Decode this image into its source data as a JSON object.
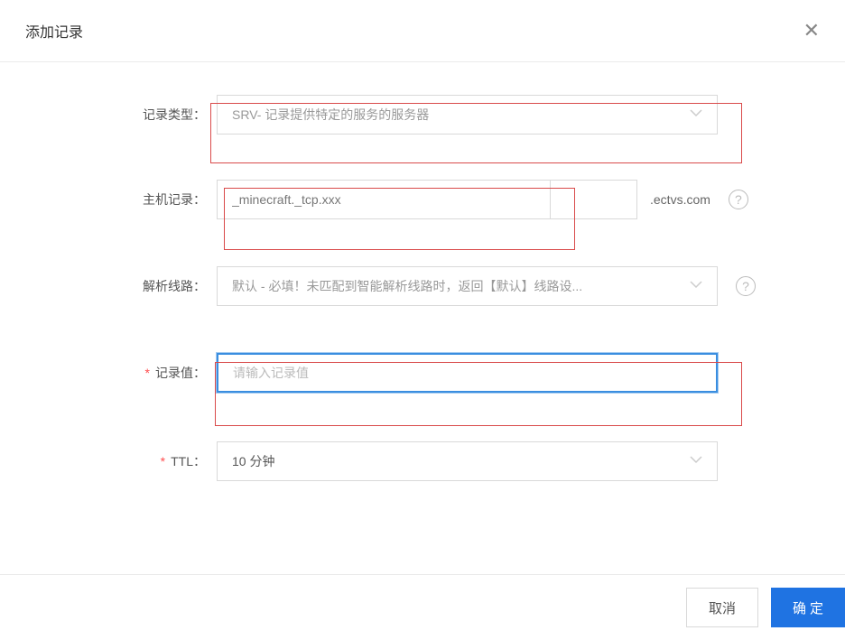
{
  "header": {
    "title": "添加记录"
  },
  "form": {
    "recordType": {
      "label": "记录类型：",
      "value": "SRV- 记录提供特定的服务的服务器"
    },
    "hostRecord": {
      "label": "主机记录：",
      "value": "_minecraft._tcp.xxx",
      "domainSuffix": ".ectvs.com"
    },
    "resolveLine": {
      "label": "解析线路：",
      "value": "默认 - 必填！未匹配到智能解析线路时，返回【默认】线路设..."
    },
    "recordValue": {
      "label": "记录值：",
      "placeholder": "请输入记录值",
      "value": ""
    },
    "ttl": {
      "label": "TTL：",
      "value": "10 分钟"
    }
  },
  "footer": {
    "cancel": "取消",
    "confirm": "确定"
  },
  "helpGlyph": "?"
}
